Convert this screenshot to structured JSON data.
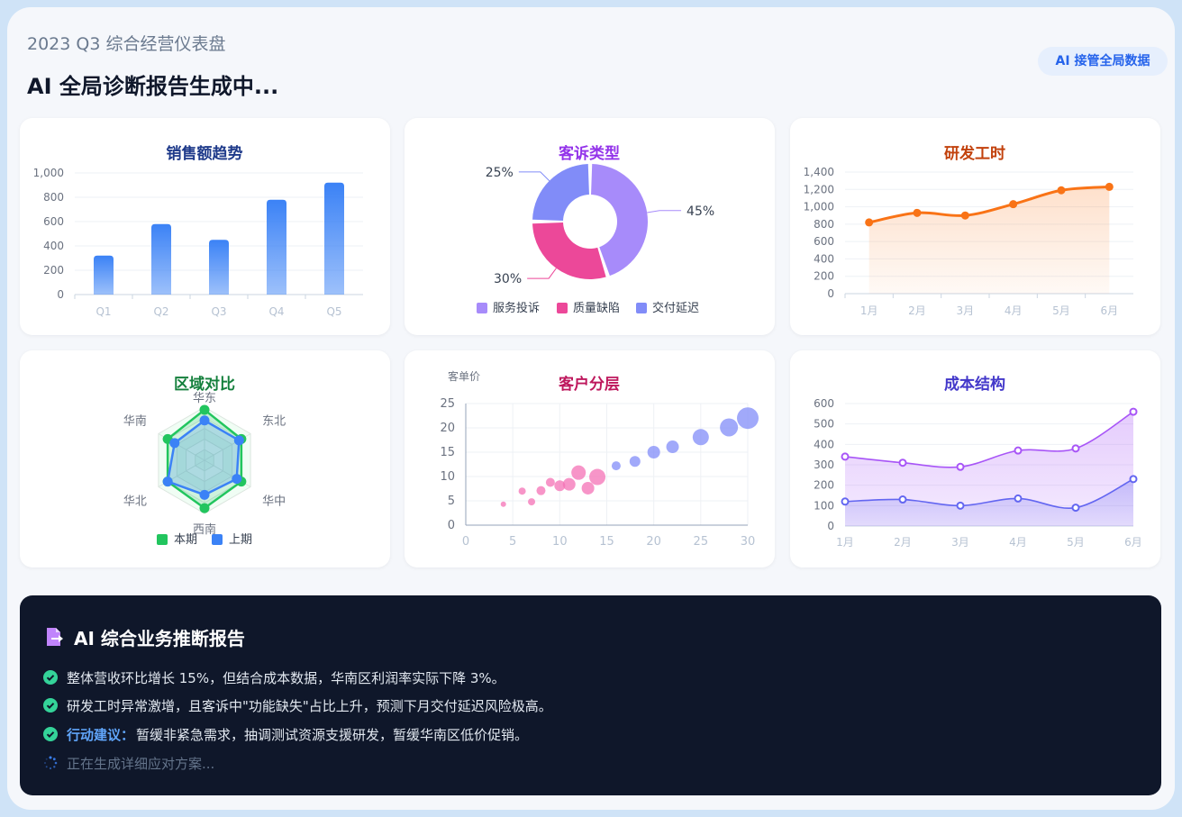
{
  "header": {
    "subtitle": "2023 Q3 综合经营仪表盘",
    "title": "AI 全局诊断报告生成中...",
    "badge": "AI 接管全局数据"
  },
  "chart_data": [
    {
      "type": "bar",
      "title": "销售额趋势",
      "title_color": "#1e3a8a",
      "categories": [
        "Q1",
        "Q2",
        "Q3",
        "Q4",
        "Q5"
      ],
      "values": [
        320,
        580,
        450,
        780,
        920
      ],
      "ylim": [
        0,
        1000
      ],
      "yticks": [
        "0",
        "200",
        "400",
        "600",
        "800",
        "1,000"
      ],
      "grid": true,
      "color": "#3b82f6"
    },
    {
      "type": "pie",
      "title": "客诉类型",
      "title_color": "#9333ea",
      "labels": [
        "服务投诉",
        "质量缺陷",
        "交付延迟"
      ],
      "values": [
        45,
        30,
        25
      ],
      "value_labels": [
        "45%",
        "30%",
        "25%"
      ],
      "colors": [
        "#a78bfa",
        "#ec4899",
        "#818cf8"
      ],
      "legend": "bottom"
    },
    {
      "type": "area",
      "title": "研发工时",
      "title_color": "#c2410c",
      "categories": [
        "1月",
        "2月",
        "3月",
        "4月",
        "5月",
        "6月"
      ],
      "values": [
        820,
        930,
        900,
        1030,
        1190,
        1230
      ],
      "ylim": [
        0,
        1400
      ],
      "yticks": [
        "0",
        "200",
        "400",
        "600",
        "800",
        "1,000",
        "1,200",
        "1,400"
      ],
      "grid": true,
      "color": "#f97316"
    },
    {
      "type": "radar",
      "title": "区域对比",
      "title_color": "#15803d",
      "axes": [
        "华东",
        "东北",
        "华中",
        "西南",
        "华北",
        "华南"
      ],
      "max": 100,
      "series": [
        {
          "name": "本期",
          "values": [
            95,
            80,
            80,
            90,
            80,
            80
          ],
          "color": "#22c55e"
        },
        {
          "name": "上期",
          "values": [
            75,
            75,
            70,
            65,
            80,
            65
          ],
          "color": "#3b82f6"
        }
      ],
      "legend": "bottom"
    },
    {
      "type": "scatter",
      "title": "客户分层",
      "title_color": "#be185d",
      "ylabel": "客单价",
      "xlim": [
        0,
        30
      ],
      "ylim": [
        0,
        25
      ],
      "xticks": [
        "0",
        "5",
        "10",
        "15",
        "20",
        "25",
        "30"
      ],
      "yticks": [
        "0",
        "5",
        "10",
        "15",
        "20",
        "25"
      ],
      "grid": true,
      "series": [
        {
          "color": "#f472b6",
          "points": [
            {
              "x": 4,
              "y": 4.3,
              "r": 3
            },
            {
              "x": 6,
              "y": 7,
              "r": 4
            },
            {
              "x": 7,
              "y": 4.8,
              "r": 4
            },
            {
              "x": 8,
              "y": 7.1,
              "r": 5
            },
            {
              "x": 9,
              "y": 8.8,
              "r": 5
            },
            {
              "x": 10,
              "y": 8.1,
              "r": 6
            },
            {
              "x": 11,
              "y": 8.4,
              "r": 7
            },
            {
              "x": 12,
              "y": 10.8,
              "r": 8
            },
            {
              "x": 13,
              "y": 7.6,
              "r": 7
            },
            {
              "x": 14,
              "y": 9.9,
              "r": 9
            }
          ]
        },
        {
          "color": "#818cf8",
          "points": [
            {
              "x": 16,
              "y": 12.2,
              "r": 5
            },
            {
              "x": 18,
              "y": 13.1,
              "r": 6
            },
            {
              "x": 20,
              "y": 15,
              "r": 7
            },
            {
              "x": 22,
              "y": 16.1,
              "r": 7
            },
            {
              "x": 25,
              "y": 18.1,
              "r": 9
            },
            {
              "x": 28,
              "y": 20.1,
              "r": 10
            },
            {
              "x": 30,
              "y": 22,
              "r": 12
            }
          ]
        }
      ]
    },
    {
      "type": "area",
      "title": "成本结构",
      "title_color": "#4338ca",
      "categories": [
        "1月",
        "2月",
        "3月",
        "4月",
        "5月",
        "6月"
      ],
      "ylim": [
        0,
        600
      ],
      "yticks": [
        "0",
        "100",
        "200",
        "300",
        "400",
        "500",
        "600"
      ],
      "grid": true,
      "series": [
        {
          "values": [
            340,
            310,
            290,
            370,
            380,
            560
          ],
          "color": "#a855f7"
        },
        {
          "values": [
            120,
            130,
            100,
            135,
            90,
            230
          ],
          "color": "#6366f1"
        }
      ]
    }
  ],
  "report": {
    "title": "AI 综合业务推断报告",
    "items": [
      {
        "highlight": "",
        "text": "整体营收环比增长 15%，但结合成本数据，华南区利润率实际下降 3%。"
      },
      {
        "highlight": "",
        "text": "研发工时异常激增，且客诉中\"功能缺失\"占比上升，预测下月交付延迟风险极高。"
      },
      {
        "highlight": "行动建议：",
        "text": "暂缓非紧急需求，抽调测试资源支援研发，暂缓华南区低价促销。"
      }
    ],
    "pending": "正在生成详细应对方案...",
    "icons": {
      "report": "file-export-icon",
      "check": "check-circle-icon",
      "loading": "spinner-icon"
    },
    "colors": {
      "check": "#34d399",
      "accent": "#c084fc"
    }
  }
}
